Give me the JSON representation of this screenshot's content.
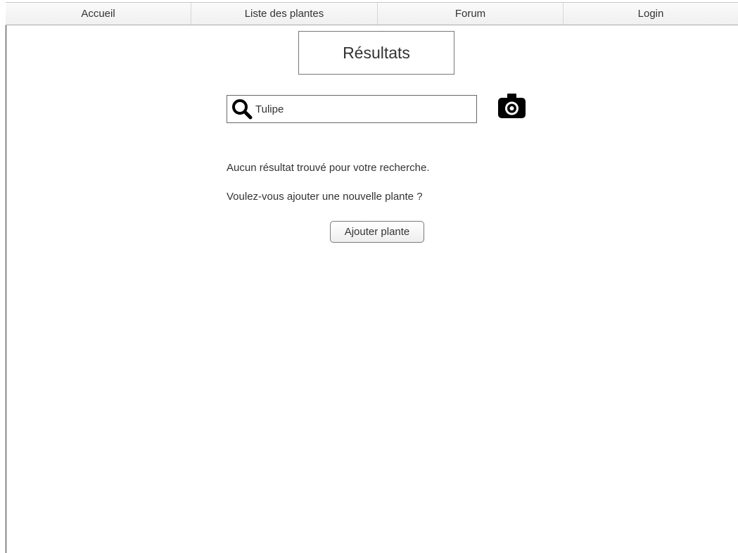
{
  "navbar": {
    "items": [
      {
        "label": "Accueil"
      },
      {
        "label": "Liste des plantes"
      },
      {
        "label": "Forum"
      },
      {
        "label": "Login"
      }
    ]
  },
  "page": {
    "title": "Résultats"
  },
  "search": {
    "value": "Tulipe",
    "icon": "search-icon"
  },
  "camera": {
    "icon": "camera-icon"
  },
  "messages": {
    "no_results": "Aucun résultat trouvé pour votre recherche.",
    "add_prompt": "Voulez-vous ajouter une nouvelle plante ?"
  },
  "actions": {
    "add_plant_label": "Ajouter plante"
  }
}
